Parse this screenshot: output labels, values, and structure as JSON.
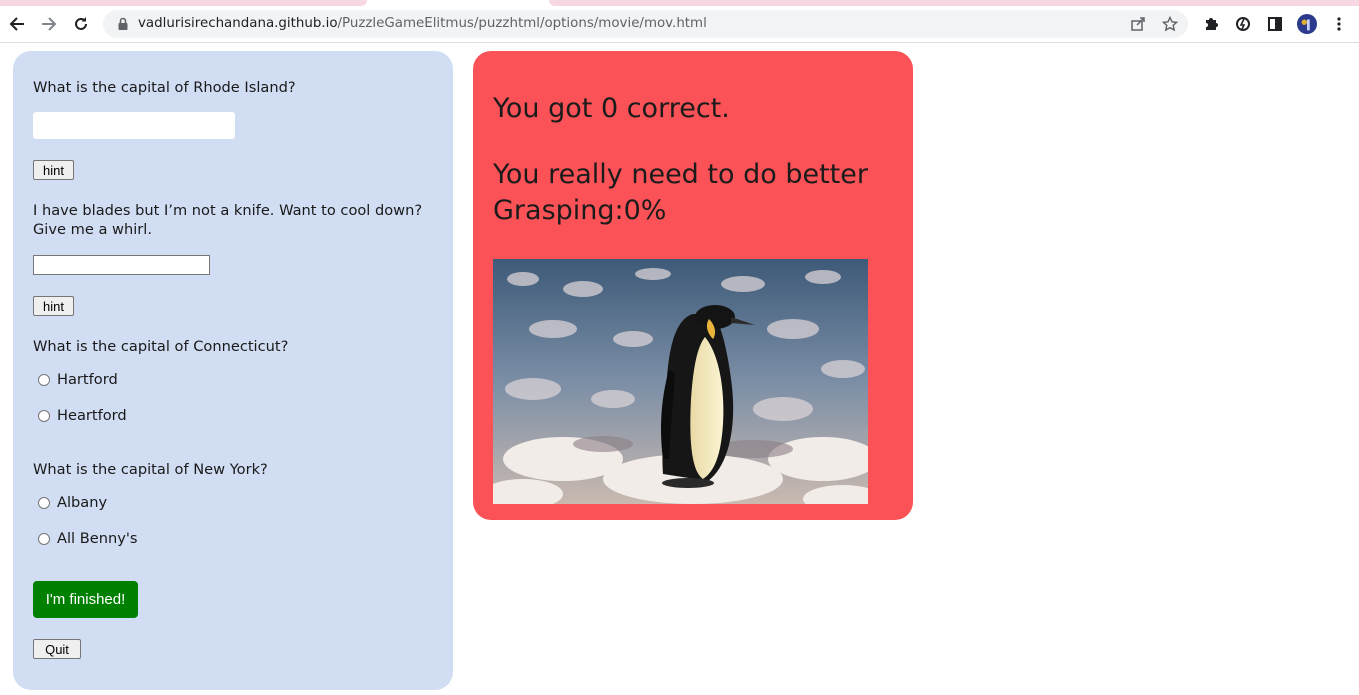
{
  "browser": {
    "url_host": "vadlurisirechandana.github.io",
    "url_path": "/PuzzleGameElitmus/puzzhtml/options/movie/mov.html"
  },
  "quiz": {
    "q1": {
      "question": "What is the capital of Rhode Island?",
      "value": "",
      "hint_label": "hint"
    },
    "q2": {
      "question": "I have blades but I’m not a knife. Want to cool down? Give me a whirl.",
      "value": "",
      "hint_label": "hint"
    },
    "q3": {
      "question": "What is the capital of Connecticut?",
      "options": [
        "Hartford",
        "Heartford"
      ]
    },
    "q4": {
      "question": "What is the capital of New York?",
      "options": [
        "Albany",
        "All Benny's"
      ]
    },
    "finish_label": "I'm finished!",
    "quit_label": "Quit",
    "colors": {
      "panel": "#d0ddf2",
      "finish": "#008000"
    }
  },
  "result": {
    "score_line": "You got 0 correct.",
    "message": "You really need to do better",
    "grasping": "Grasping:0%",
    "image": "penguin-image",
    "colors": {
      "panel": "#fa5257"
    }
  }
}
